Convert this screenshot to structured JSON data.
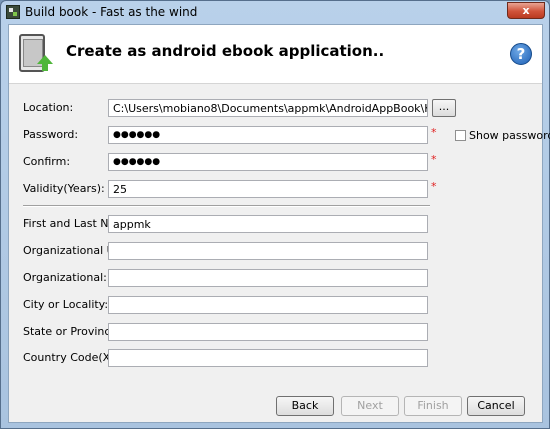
{
  "window": {
    "title": "Build book - Fast as the wind",
    "close_label": "x"
  },
  "header": {
    "title": "Create as android ebook application..",
    "help_label": "?"
  },
  "form": {
    "location": {
      "label": "Location:",
      "value": "C:\\Users\\mobiano8\\Documents\\appmk\\AndroidAppBook\\Keys\\default.key",
      "browse_label": "..."
    },
    "password": {
      "label": "Password:",
      "value": "●●●●●●",
      "required": "*",
      "show_password_label": "Show password"
    },
    "confirm": {
      "label": "Confirm:",
      "value": "●●●●●●",
      "required": "*"
    },
    "validity": {
      "label": "Validity(Years):",
      "value": "25",
      "required": "*"
    },
    "first_last_name": {
      "label": "First and Last Name:",
      "value": "appmk"
    },
    "org_unit": {
      "label": "Organizational Unit:",
      "value": ""
    },
    "organizational": {
      "label": "Organizational:",
      "value": ""
    },
    "city": {
      "label": "City or Locality:",
      "value": ""
    },
    "state": {
      "label": "State or Province:",
      "value": ""
    },
    "country": {
      "label": "Country Code(XX):",
      "value": ""
    }
  },
  "buttons": {
    "back": "Back",
    "next": "Next",
    "finish": "Finish",
    "cancel": "Cancel"
  }
}
